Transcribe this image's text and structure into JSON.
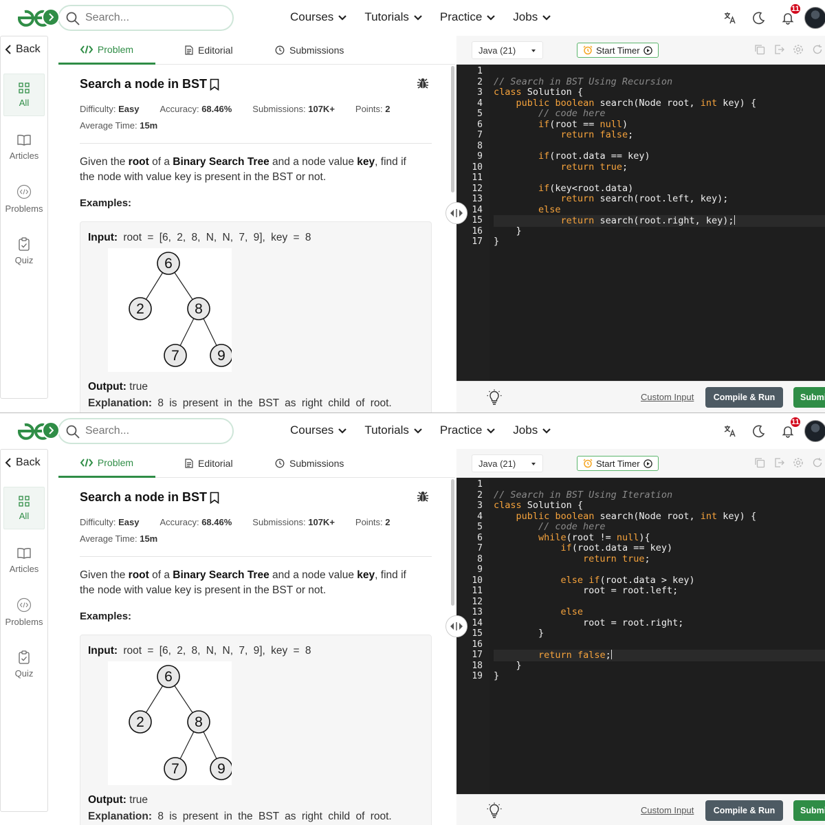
{
  "nav": {
    "search_placeholder": "Search...",
    "links": [
      "Courses",
      "Tutorials",
      "Practice",
      "Jobs"
    ],
    "notification_count": "11"
  },
  "rail": {
    "back_label": "Back",
    "items": [
      "All",
      "Articles",
      "Problems",
      "Quiz"
    ]
  },
  "tabs": [
    "Problem",
    "Editorial",
    "Submissions"
  ],
  "problem": {
    "title": "Search a node in BST",
    "difficulty_label": "Difficulty:",
    "difficulty": "Easy",
    "accuracy_label": "Accuracy:",
    "accuracy": "68.46%",
    "submissions_label": "Submissions:",
    "submissions": "107K+",
    "points_label": "Points:",
    "points": "2",
    "avg_time_label": "Average Time:",
    "avg_time": "15m",
    "desc_1": "Given the ",
    "desc_root": "root",
    "desc_2": " of a ",
    "desc_bst": "Binary Search Tree",
    "desc_3": " and a node value ",
    "desc_key": "key",
    "desc_4": ", find if the node with value key is present in the BST or not.",
    "examples_label": "Examples:",
    "input_label": "Input:",
    "input_value": "root = [6, 2, 8, N, N, 7, 9], key = 8",
    "tree_nodes": [
      "6",
      "2",
      "8",
      "7",
      "9"
    ],
    "output_label": "Output:",
    "output_value": "true",
    "explanation_label": "Explanation:",
    "explanation_value": "8 is present in the BST as right child of root."
  },
  "editor": {
    "language": "Java (21)",
    "timer_label": "Start Timer",
    "custom_input": "Custom Input",
    "compile_run": "Compile & Run",
    "submit": "Submit",
    "recursion_lines": [
      [],
      [
        {
          "t": "// Search in BST Using Recursion",
          "c": "cm"
        }
      ],
      [
        {
          "t": "class",
          "c": "kw"
        },
        {
          "t": " Solution {"
        }
      ],
      [
        {
          "t": "    "
        },
        {
          "t": "public",
          "c": "kw"
        },
        {
          "t": " "
        },
        {
          "t": "boolean",
          "c": "kw"
        },
        {
          "t": " search(Node root, "
        },
        {
          "t": "int",
          "c": "kw"
        },
        {
          "t": " key) {"
        }
      ],
      [
        {
          "t": "        "
        },
        {
          "t": "// code here",
          "c": "cm"
        }
      ],
      [
        {
          "t": "        "
        },
        {
          "t": "if",
          "c": "kw"
        },
        {
          "t": "(root == "
        },
        {
          "t": "null",
          "c": "kw"
        },
        {
          "t": ")"
        }
      ],
      [
        {
          "t": "            "
        },
        {
          "t": "return",
          "c": "kw"
        },
        {
          "t": " "
        },
        {
          "t": "false",
          "c": "kw"
        },
        {
          "t": ";"
        }
      ],
      [],
      [
        {
          "t": "        "
        },
        {
          "t": "if",
          "c": "kw"
        },
        {
          "t": "(root.data == key)"
        }
      ],
      [
        {
          "t": "            "
        },
        {
          "t": "return",
          "c": "kw"
        },
        {
          "t": " "
        },
        {
          "t": "true",
          "c": "kw"
        },
        {
          "t": ";"
        }
      ],
      [],
      [
        {
          "t": "        "
        },
        {
          "t": "if",
          "c": "kw"
        },
        {
          "t": "(key<root.data)"
        }
      ],
      [
        {
          "t": "            "
        },
        {
          "t": "return",
          "c": "kw"
        },
        {
          "t": " search(root.left, key);"
        }
      ],
      [
        {
          "t": "        "
        },
        {
          "t": "else",
          "c": "kw"
        }
      ],
      [
        {
          "t": "            "
        },
        {
          "t": "return",
          "c": "kw"
        },
        {
          "t": " search(root.right, key);"
        }
      ],
      [
        {
          "t": "    }"
        }
      ],
      [
        {
          "t": "}"
        }
      ]
    ],
    "iteration_lines": [
      [],
      [
        {
          "t": "// Search in BST Using Iteration",
          "c": "cm"
        }
      ],
      [
        {
          "t": "class",
          "c": "kw"
        },
        {
          "t": " Solution {"
        }
      ],
      [
        {
          "t": "    "
        },
        {
          "t": "public",
          "c": "kw"
        },
        {
          "t": " "
        },
        {
          "t": "boolean",
          "c": "kw"
        },
        {
          "t": " search(Node root, "
        },
        {
          "t": "int",
          "c": "kw"
        },
        {
          "t": " key) {"
        }
      ],
      [
        {
          "t": "        "
        },
        {
          "t": "// code here",
          "c": "cm"
        }
      ],
      [
        {
          "t": "        "
        },
        {
          "t": "while",
          "c": "kw"
        },
        {
          "t": "(root != "
        },
        {
          "t": "null",
          "c": "kw"
        },
        {
          "t": "){"
        }
      ],
      [
        {
          "t": "            "
        },
        {
          "t": "if",
          "c": "kw"
        },
        {
          "t": "(root.data == key)"
        }
      ],
      [
        {
          "t": "                "
        },
        {
          "t": "return",
          "c": "kw"
        },
        {
          "t": " "
        },
        {
          "t": "true",
          "c": "kw"
        },
        {
          "t": ";"
        }
      ],
      [],
      [
        {
          "t": "            "
        },
        {
          "t": "else",
          "c": "kw"
        },
        {
          "t": " "
        },
        {
          "t": "if",
          "c": "kw"
        },
        {
          "t": "(root.data > key)"
        }
      ],
      [
        {
          "t": "                root = root.left;"
        }
      ],
      [],
      [
        {
          "t": "            "
        },
        {
          "t": "else",
          "c": "kw"
        }
      ],
      [
        {
          "t": "                root = root.right;"
        }
      ],
      [
        {
          "t": "        }"
        }
      ],
      [],
      [
        {
          "t": "        "
        },
        {
          "t": "return",
          "c": "kw"
        },
        {
          "t": " "
        },
        {
          "t": "false",
          "c": "kw"
        },
        {
          "t": ";"
        }
      ],
      [
        {
          "t": "    }"
        }
      ],
      [
        {
          "t": "}"
        }
      ]
    ]
  }
}
